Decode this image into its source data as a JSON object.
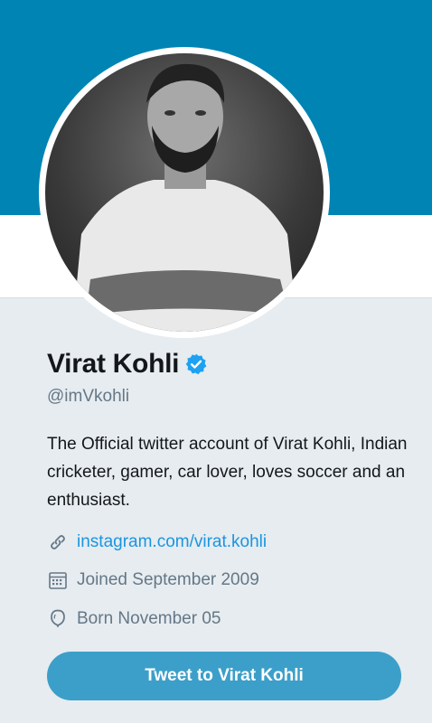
{
  "profile": {
    "name": "Virat Kohli",
    "handle": "@imVkohli",
    "bio": "The Official twitter account of Virat Kohli, Indian cricketer, gamer, car lover, loves soccer and an enthusiast.",
    "website": "instagram.com/virat.kohli",
    "joined": "Joined September 2009",
    "born": "Born November 05",
    "verified": true
  },
  "actions": {
    "tweet_to_label": "Tweet to Virat Kohli"
  },
  "icons": {
    "verified": "verified-badge-icon",
    "link": "link-icon",
    "calendar": "calendar-icon",
    "balloon": "balloon-icon"
  },
  "colors": {
    "banner": "#0084b4",
    "background": "#e6ecf0",
    "link": "#1b95e0",
    "button": "#3c9fc9",
    "verified": "#1da1f2"
  }
}
